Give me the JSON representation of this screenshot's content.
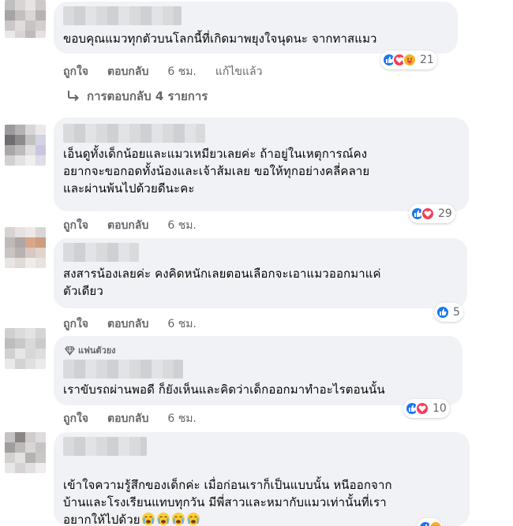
{
  "colors": {
    "bubble_bg": "#f0f2f5",
    "meta_text": "#65676b",
    "like_blue": "#1877f2",
    "love_red": "#f33e58",
    "care_yellow": "#f7b125"
  },
  "comments": [
    {
      "text": "ขอบคุณแมวทุกตัวบนโลกนี้ที่เกิดมาพยุงใจนุดนะ จากทาสแมว",
      "actions": {
        "like": "ถูกใจ",
        "reply": "ตอบกลับ",
        "time": "6 ชม.",
        "edited": "แก้ไขแล้ว"
      },
      "reactions": {
        "icons": [
          "like-icon",
          "love-icon",
          "care-icon"
        ],
        "count": "21"
      },
      "replies": "การตอบกลับ 4 รายการ"
    },
    {
      "text": "เอ็นดูทั้งเด็กน้อยและแมวเหมียวเลยค่ะ ถ้าอยู่ในเหตุการณ์คง\nอยากจะขอกอดทั้งน้องและเจ้าส้มเลย ขอให้ทุกอย่างคลี่คลาย\nและผ่านพ้นไปด้วยดีนะคะ",
      "actions": {
        "like": "ถูกใจ",
        "reply": "ตอบกลับ",
        "time": "6 ชม."
      },
      "reactions": {
        "icons": [
          "like-icon",
          "love-icon"
        ],
        "count": "29"
      }
    },
    {
      "text": "สงสารน้องเลยค่ะ คงคิดหนักเลยตอนเลือกจะเอาแมวออกมาแค่\nตัวเดียว",
      "actions": {
        "like": "ถูกใจ",
        "reply": "ตอบกลับ",
        "time": "6 ชม."
      },
      "reactions": {
        "icons": [
          "like-icon"
        ],
        "count": "5"
      }
    },
    {
      "badge": "แฟนตัวยง",
      "text": "เราขับรถผ่านพอดี ก็ยังเห็นและคิดว่าเด็กออกมาทำอะไรตอนนั้น",
      "actions": {
        "like": "ถูกใจ",
        "reply": "ตอบกลับ",
        "time": "6 ชม."
      },
      "reactions": {
        "icons": [
          "like-icon",
          "love-icon"
        ],
        "count": "10"
      }
    },
    {
      "text": "เข้าใจความรู้สึกของเด็กค่ะ เมื่อก่อนเราก็เป็นแบบนั้น หนีออกจาก\nบ้านและโรงเรียนแทบทุกวัน มีพี่สาวและหมากับแมวเท่านั้นที่เรา\nอยากให้ไปด้วย",
      "emoji_suffix": [
        "crying-face-icon",
        "crying-face-icon",
        "crying-face-icon",
        "crying-face-icon"
      ]
    }
  ]
}
